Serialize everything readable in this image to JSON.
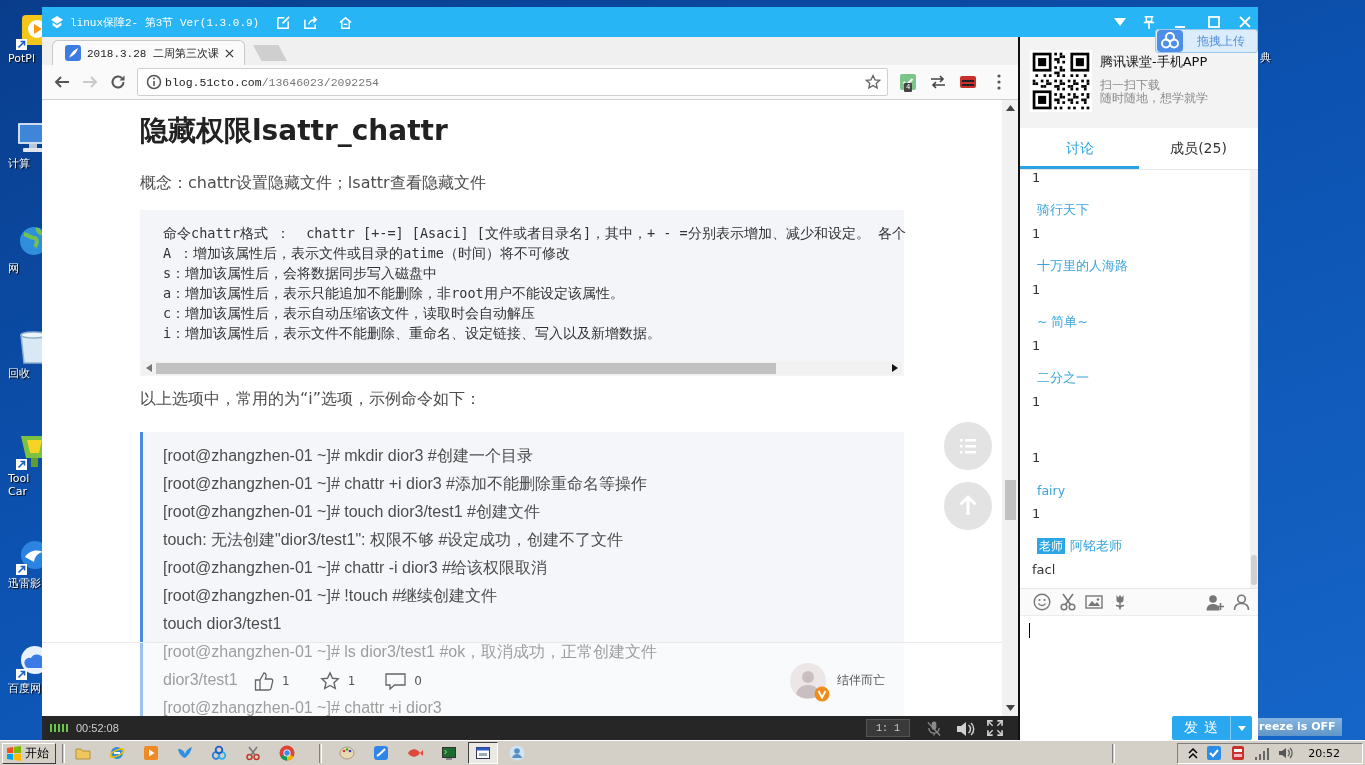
{
  "desktop": {
    "icons": [
      {
        "kind": "player",
        "label": "PotPl"
      },
      {
        "kind": "computer",
        "label": "计算"
      },
      {
        "kind": "network",
        "label": "网"
      },
      {
        "kind": "recycle",
        "label": "回收"
      },
      {
        "kind": "tool",
        "label": "Tool\nCar"
      },
      {
        "kind": "thunder",
        "label": "迅雷影"
      },
      {
        "kind": "cloud",
        "label": "百度网"
      }
    ],
    "right_label": "典",
    "notice": "reeze is OFF"
  },
  "window": {
    "title": "linux保障2- 第3节 Ver(1.3.0.9)",
    "upload_button": "拖拽上传"
  },
  "browser": {
    "tab": {
      "label": "2018.3.28 二周第三次课"
    },
    "nav": [
      {
        "kind": "back",
        "disabled": false
      },
      {
        "kind": "forward",
        "disabled": true
      },
      {
        "kind": "reload",
        "disabled": false
      }
    ],
    "address": {
      "host": "blog.51cto.com",
      "path": "/13646023/2092254"
    },
    "extension_badge": "4"
  },
  "article": {
    "title": "隐藏权限lsattr_chattr",
    "intro": "概念：chattr设置隐藏文件；lsattr查看隐藏文件",
    "options": [
      "命令chattr格式 ：  chattr [+-=] [Asaci] [文件或者目录名]，其中，+ - =分别表示增加、减少和设定。 各个",
      "A ：增加该属性后，表示文件或目录的atime（时间）将不可修改",
      "s：增加该属性后，会将数据同步写入磁盘中",
      "a：增加该属性后，表示只能追加不能删除，非root用户不能设定该属性。",
      "c：增加该属性后，表示自动压缩该文件，读取时会自动解压",
      "i：增加该属性后，表示文件不能删除、重命名、设定链接、写入以及新增数据。"
    ],
    "lead": "以上选项中，常用的为“i”选项，示例命令如下：",
    "example": [
      "[root@zhangzhen-01 ~]# mkdir dior3 #创建一个目录",
      "[root@zhangzhen-01 ~]# chattr +i dior3 #添加不能删除重命名等操作",
      "[root@zhangzhen-01 ~]# touch dior3/test1 #创建文件",
      "touch: 无法创建\"dior3/test1\": 权限不够 #设定成功，创建不了文件",
      "[root@zhangzhen-01 ~]# chattr -i dior3 #给该权限取消",
      "[root@zhangzhen-01 ~]# !touch #继续创建文件",
      "touch dior3/test1",
      "[root@zhangzhen-01 ~]# ls dior3/test1 #ok，取消成功，正常创建文件",
      "dior3/test1",
      "[root@zhangzhen-01 ~]# chattr +i dior3"
    ],
    "likes": "1",
    "favorites": "1",
    "comments": "0",
    "author": "结伴而亡"
  },
  "player": {
    "time": "00:52:08",
    "ratio": "1: 1"
  },
  "side": {
    "app": {
      "title": "腾讯课堂-手机APP",
      "line_1": "扫一扫下载",
      "line_2": "随时随地，想学就学"
    },
    "tabs": [
      {
        "label": "讨论",
        "selected": true
      },
      {
        "label": "成员(25)",
        "selected": false
      }
    ],
    "messages": [
      {
        "kind": "cut",
        "text": "1"
      },
      {
        "kind": "message",
        "name": "骑行天下",
        "text": "1"
      },
      {
        "kind": "message",
        "name": "十万里的人海路",
        "text": "1"
      },
      {
        "kind": "message",
        "name": "~ 简单~",
        "text": "1"
      },
      {
        "kind": "message",
        "name": "二分之一",
        "text": "1"
      },
      {
        "kind": "message",
        "text": "1"
      },
      {
        "kind": "message",
        "name": "fairy",
        "text": "1"
      },
      {
        "kind": "message",
        "badge": "老师",
        "name": "阿铭老师",
        "text": "facl"
      }
    ],
    "send": "发送"
  },
  "taskbar": {
    "start": "开始",
    "tasks": [
      {
        "kind": "palette",
        "selected": false
      },
      {
        "kind": "tile",
        "selected": false
      },
      {
        "kind": "fish",
        "selected": false
      },
      {
        "kind": "terminal",
        "selected": false
      },
      {
        "kind": "window",
        "selected": true
      },
      {
        "kind": "person",
        "selected": false
      }
    ],
    "clock": "20:52"
  }
}
